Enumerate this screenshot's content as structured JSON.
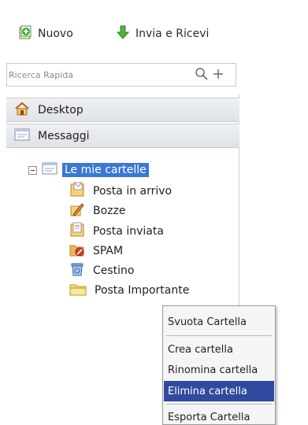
{
  "toolbar": {
    "new_label": "Nuovo",
    "send_receive_label": "Invia e Ricevi"
  },
  "search": {
    "placeholder": "Ricerca Rapida"
  },
  "nav": {
    "desktop_label": "Desktop",
    "messages_label": "Messaggi"
  },
  "tree": {
    "root_label": "Le mie cartelle",
    "folders": [
      {
        "label": "Posta in arrivo",
        "icon": "inbox-icon"
      },
      {
        "label": "Bozze",
        "icon": "drafts-icon"
      },
      {
        "label": "Posta inviata",
        "icon": "sent-icon"
      },
      {
        "label": "SPAM",
        "icon": "spam-icon"
      },
      {
        "label": "Cestino",
        "icon": "trash-icon"
      },
      {
        "label": "Posta Importante",
        "icon": "folder-icon"
      }
    ]
  },
  "context_menu": {
    "items": [
      {
        "label": "Svuota Cartella"
      },
      {
        "label": "Crea cartella"
      },
      {
        "label": "Rinomina cartella"
      },
      {
        "label": "Elimina cartella"
      },
      {
        "label": "Esporta Cartella"
      }
    ],
    "selected": "Elimina cartella"
  },
  "colors": {
    "selection": "#3a78d4",
    "menu_highlight": "#2f4a9e",
    "panel_row": "#e6e9ed"
  }
}
